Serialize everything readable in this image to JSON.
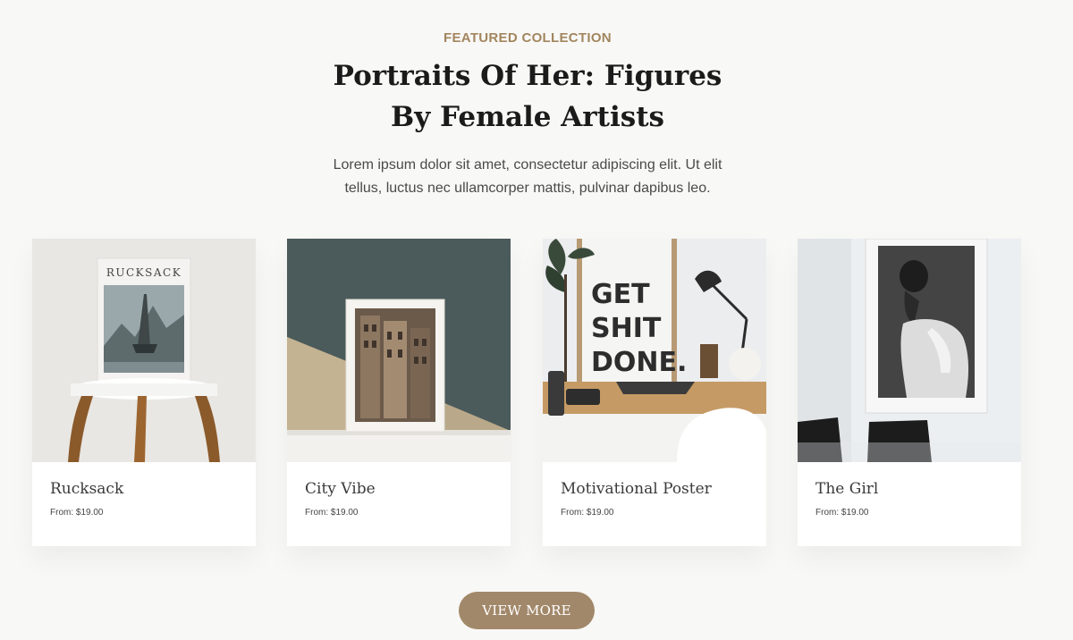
{
  "section": {
    "eyebrow": "FEATURED COLLECTION",
    "title": "Portraits Of Her: Figures By Female Artists",
    "description": "Lorem ipsum dolor sit amet, consectetur adipiscing elit. Ut elit tellus, luctus nec ullamcorper mattis, pulvinar dapibus leo."
  },
  "products": [
    {
      "name": "Rucksack",
      "price": "From: $19.00",
      "image": "framed-print-rucksack-on-stool",
      "image_text": "RUCKSACK"
    },
    {
      "name": "City Vibe",
      "price": "From: $19.00",
      "image": "framed-print-city-buildings"
    },
    {
      "name": "Motivational Poster",
      "price": "From: $19.00",
      "image": "get-shit-done-poster-desk",
      "image_text": [
        "GET",
        "SHIT",
        "DONE."
      ]
    },
    {
      "name": "The Girl",
      "price": "From: $19.00",
      "image": "framed-portrait-woman"
    }
  ],
  "cta": {
    "label": "VIEW MORE"
  },
  "colors": {
    "accent": "#a2865f",
    "button": "#a2886a",
    "background": "#f8f8f6"
  }
}
